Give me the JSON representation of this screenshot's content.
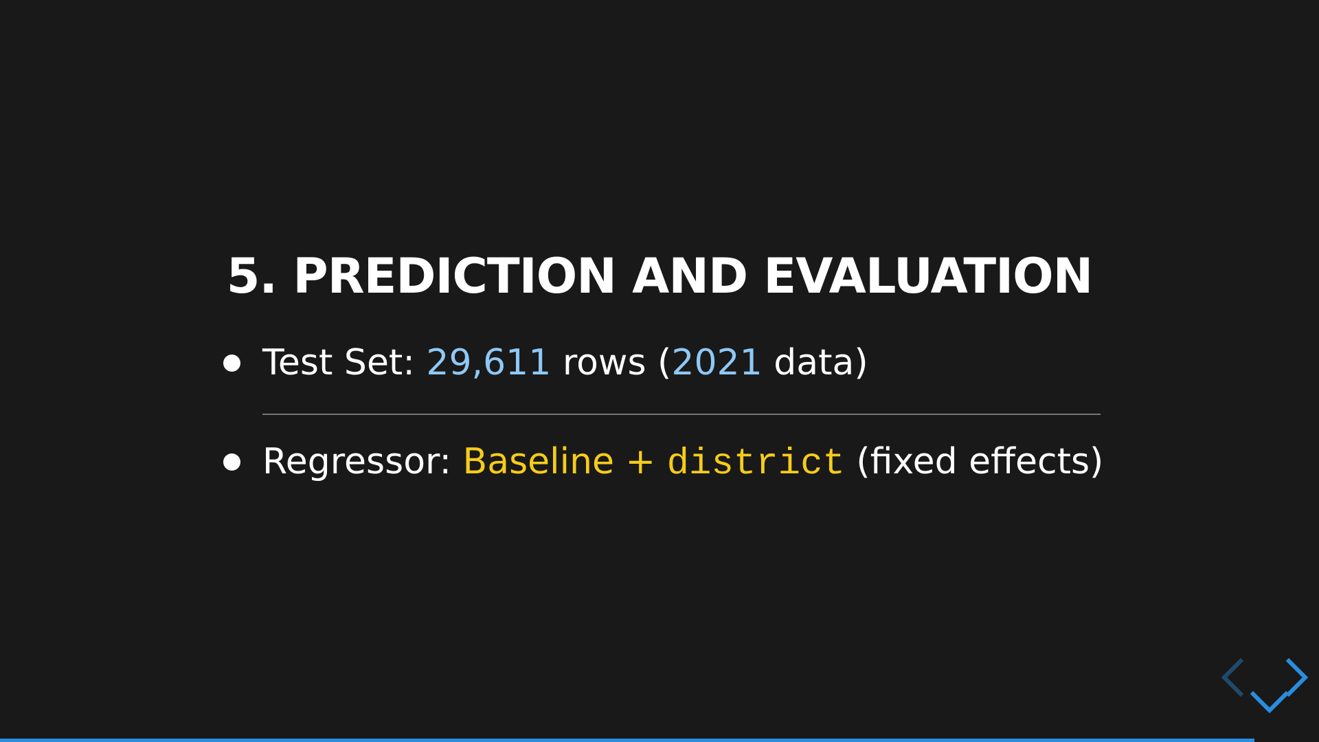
{
  "slide": {
    "title": "5. PREDICTION AND EVALUATION",
    "bullets": [
      {
        "label": "Test Set: ",
        "value1": "29,611",
        "mid": " rows (",
        "value2": "2021",
        "end": " data)"
      },
      {
        "label": "Regressor: ",
        "highlight": "Baseline + ",
        "code": "district",
        "end": " (fixed effects)"
      }
    ]
  },
  "navigation": {
    "left_icon": "chevron-left-icon",
    "right_icon": "chevron-right-icon",
    "down_icon": "chevron-down-icon"
  },
  "progress": {
    "fraction": 0.951
  },
  "colors": {
    "background": "#191919",
    "number_accent": "#8ec8f6",
    "highlight": "#f6cc1a",
    "nav_accent": "#2a8ddd",
    "nav_disabled": "#1f4a6c"
  }
}
